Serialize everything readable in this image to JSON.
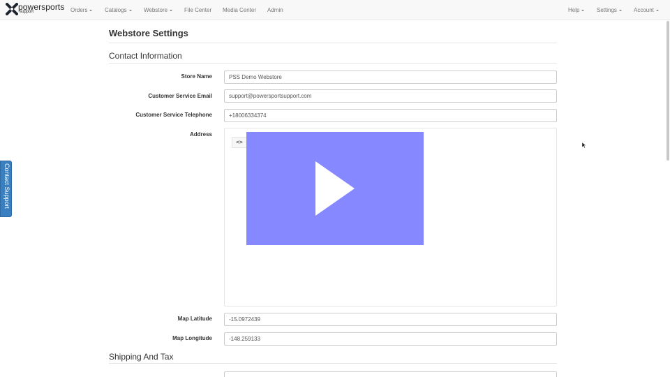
{
  "brand": {
    "name": "powersports",
    "sub": "support"
  },
  "nav": {
    "left": [
      {
        "label": "Orders",
        "dropdown": true
      },
      {
        "label": "Catalogs",
        "dropdown": true
      },
      {
        "label": "Webstore",
        "dropdown": true
      },
      {
        "label": "File Center",
        "dropdown": false
      },
      {
        "label": "Media Center",
        "dropdown": false
      },
      {
        "label": "Admin",
        "dropdown": false
      }
    ],
    "right": [
      {
        "label": "Help",
        "dropdown": true
      },
      {
        "label": "Settings",
        "dropdown": true
      },
      {
        "label": "Account",
        "dropdown": true
      }
    ]
  },
  "contact_tab": "Contact Support",
  "page": {
    "title": "Webstore Settings"
  },
  "contact_section": {
    "title": "Contact Information",
    "store_name": {
      "label": "Store Name",
      "value": "PSS Demo Webstore"
    },
    "email": {
      "label": "Customer Service Email",
      "value": "support@powersportsupport.com"
    },
    "phone": {
      "label": "Customer Service Telephone",
      "value": "+18006334374"
    },
    "address": {
      "label": "Address",
      "value": ""
    },
    "editor_toolbar": {
      "code": "<>",
      "tools": [
        "paragraph-icon",
        "bold-icon",
        "italic-icon",
        "strikethrough-icon",
        "list-icon",
        "image-icon",
        "link-icon"
      ]
    },
    "map_latitude": {
      "label": "Map Latitude",
      "value": "-15.0972439"
    },
    "map_longitude": {
      "label": "Map Longitude",
      "value": "-148.259133"
    }
  },
  "shipping_section": {
    "title": "Shipping And Tax"
  },
  "colors": {
    "navbar_bg": "#f8f8f8",
    "video_overlay": "#8588ff",
    "contact_tab": "#3a7fbf"
  }
}
